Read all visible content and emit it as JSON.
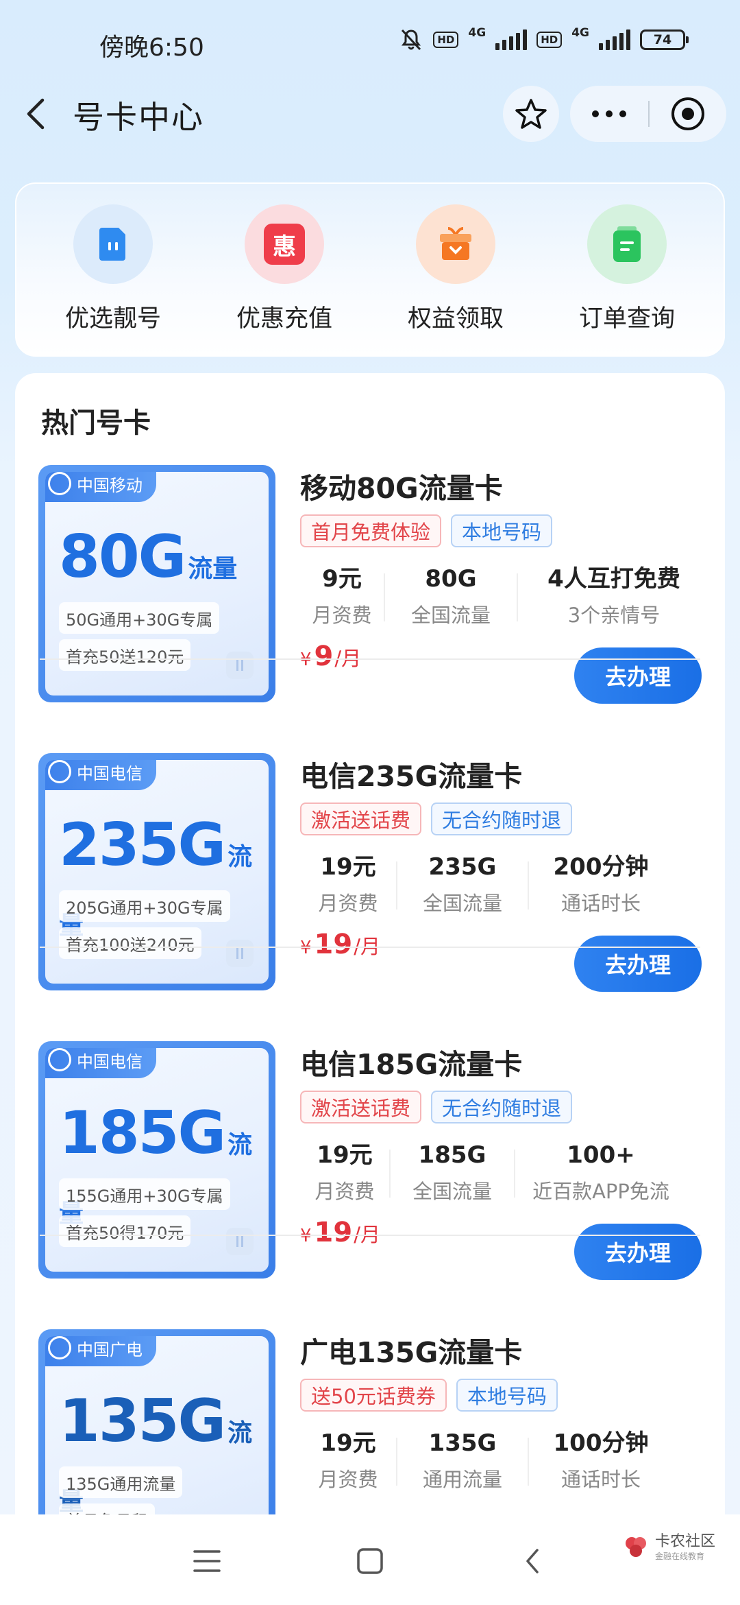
{
  "status_bar": {
    "time": "傍晚6:50",
    "hd1": "HD",
    "net1": "4G",
    "hd2": "HD",
    "net2": "4G",
    "battery": "74"
  },
  "header": {
    "title": "号卡中心",
    "icons": [
      "back-arrow-icon",
      "star-icon",
      "more-icon",
      "close-circle-icon"
    ]
  },
  "quick_actions": [
    {
      "label": "优选靓号",
      "icon": "sim-card-icon",
      "color": "#2f8bf0"
    },
    {
      "label": "优惠充值",
      "icon": "discount-icon",
      "glyph": "惠",
      "color": "#ef3d4a"
    },
    {
      "label": "权益领取",
      "icon": "gift-box-icon",
      "color": "#f57723"
    },
    {
      "label": "订单查询",
      "icon": "order-icon",
      "color": "#2bc45e"
    }
  ],
  "section": {
    "title": "热门号卡"
  },
  "products": [
    {
      "name": "移动80G流量卡",
      "carrier": "中国移动",
      "big": "80G",
      "big_unit": "流量",
      "line1": "50G通用+30G专属",
      "line2": "首充50送120元",
      "tags": [
        {
          "text": "首月免费体验",
          "style": "red"
        },
        {
          "text": "本地号码",
          "style": "blue"
        }
      ],
      "stats": [
        {
          "value": "9元",
          "label": "月资费"
        },
        {
          "value": "80G",
          "label": "全国流量"
        },
        {
          "value": "4人互打免费",
          "label": "3个亲情号"
        }
      ],
      "price_currency": "¥",
      "price_amount": "9",
      "price_unit": "/月",
      "button": "去办理"
    },
    {
      "name": "电信235G流量卡",
      "carrier": "中国电信",
      "big": "235G",
      "big_unit": "流量",
      "line1": "205G通用+30G专属",
      "line2": "首充100送240元",
      "tags": [
        {
          "text": "激活送话费",
          "style": "red"
        },
        {
          "text": "无合约随时退",
          "style": "blue"
        }
      ],
      "stats": [
        {
          "value": "19元",
          "label": "月资费"
        },
        {
          "value": "235G",
          "label": "全国流量"
        },
        {
          "value": "200分钟",
          "label": "通话时长"
        }
      ],
      "price_currency": "¥",
      "price_amount": "19",
      "price_unit": "/月",
      "button": "去办理"
    },
    {
      "name": "电信185G流量卡",
      "carrier": "中国电信",
      "big": "185G",
      "big_unit": "流量",
      "line1": "155G通用+30G专属",
      "line2": "首充50得170元",
      "tags": [
        {
          "text": "激活送话费",
          "style": "red"
        },
        {
          "text": "无合约随时退",
          "style": "blue"
        }
      ],
      "stats": [
        {
          "value": "19元",
          "label": "月资费"
        },
        {
          "value": "185G",
          "label": "全国流量"
        },
        {
          "value": "100+",
          "label": "近百款APP免流"
        }
      ],
      "price_currency": "¥",
      "price_amount": "19",
      "price_unit": "/月",
      "button": "去办理"
    },
    {
      "name": "广电135G流量卡",
      "carrier": "中国广电",
      "big": "135G",
      "big_unit": "流量",
      "line1": "135G通用流量",
      "line2": "首月免月租",
      "tags": [
        {
          "text": "送50元话费券",
          "style": "red"
        },
        {
          "text": "本地号码",
          "style": "blue"
        }
      ],
      "stats": [
        {
          "value": "19元",
          "label": "月资费"
        },
        {
          "value": "135G",
          "label": "通用流量"
        },
        {
          "value": "100分钟",
          "label": "通话时长"
        }
      ],
      "price_currency": "",
      "price_amount": "",
      "price_unit": "",
      "button": ""
    }
  ],
  "bottom_nav": {
    "icons": [
      "menu-icon",
      "home-square-icon",
      "back-nav-icon"
    ],
    "watermark_title": "卡农社区",
    "watermark_sub": "金融在线教育"
  }
}
